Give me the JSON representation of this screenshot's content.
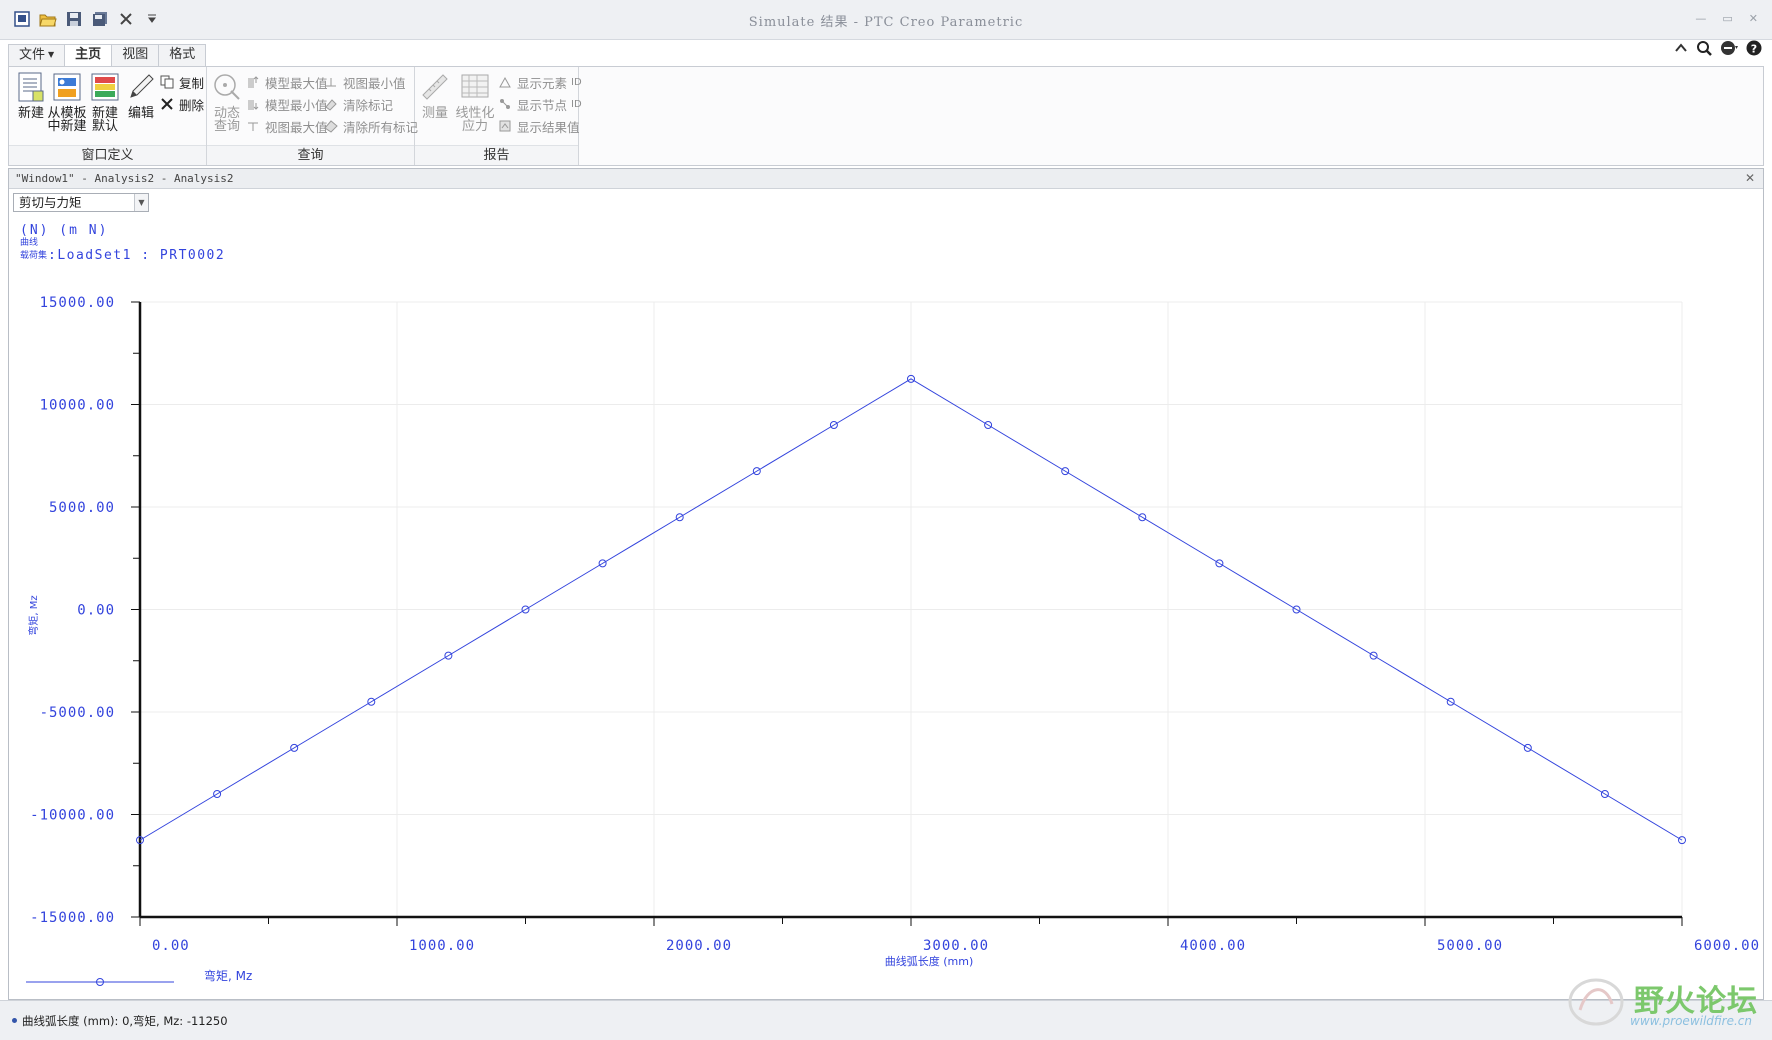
{
  "window": {
    "title": "Simulate 结果 - PTC Creo Parametric",
    "min": "—",
    "max": "▭",
    "close": "✕"
  },
  "tabs": [
    {
      "label": "文件"
    },
    {
      "label": "主页"
    },
    {
      "label": "视图"
    },
    {
      "label": "格式"
    }
  ],
  "ribbon": {
    "groups": {
      "window_def": "窗口定义",
      "query": "查询",
      "report": "报告"
    },
    "window_def": {
      "new": "新建",
      "from_template_1": "从模板",
      "from_template_2": "中新建",
      "new_default_1": "新建",
      "new_default_2": "默认",
      "edit": "编辑",
      "copy": "复制",
      "delete": "删除"
    },
    "query": {
      "dynamic_1": "动态",
      "dynamic_2": "查询",
      "model_max": "模型最大值",
      "model_min": "模型最小值",
      "view_max": "视图最大值",
      "view_min": "视图最小值",
      "clear_label": "清除标记",
      "clear_all_labels": "清除所有标记"
    },
    "report": {
      "measure": "测量",
      "linearize_1": "线性化",
      "linearize_2": "应力",
      "show_element_id": "显示元素",
      "show_node_id": "显示节点",
      "id_suffix": "ID",
      "show_result_value": "显示结果值"
    }
  },
  "result_window": {
    "title": "\"Window1\" - Analysis2 - Analysis2",
    "dropdown_value": "剪切与力矩"
  },
  "chart_data": {
    "type": "line",
    "units_line": "(N)  (m N)",
    "curve_label": "曲线",
    "loadset_label": "载荷集",
    "loadset_value": ":LoadSet1 :  PRT0002",
    "xlabel": "曲线弧长度 (mm)",
    "ylabel": "弯矩, Mz",
    "xlim": [
      0,
      6000
    ],
    "ylim": [
      -15000,
      15000
    ],
    "x_ticks": [
      "0.00",
      "1000.00",
      "2000.00",
      "3000.00",
      "4000.00",
      "5000.00",
      "6000.00"
    ],
    "y_ticks": [
      "15000.00",
      "10000.00",
      "5000.00",
      "0.00",
      "-5000.00",
      "-10000.00",
      "-15000.00"
    ],
    "legend": "弯矩, Mz",
    "line_color": "#3344dd",
    "series": [
      {
        "name": "弯矩, Mz",
        "x": [
          0,
          300,
          600,
          900,
          1200,
          1500,
          1800,
          2100,
          2400,
          2700,
          3000,
          3300,
          3600,
          3900,
          4200,
          4500,
          4800,
          5100,
          5400,
          5700,
          6000
        ],
        "y": [
          -11250,
          -9000,
          -6750,
          -4500,
          -2250,
          0,
          2250,
          4500,
          6750,
          9000,
          11250,
          9000,
          6750,
          4500,
          2250,
          0,
          -2250,
          -4500,
          -6750,
          -9000,
          -11250
        ]
      }
    ]
  },
  "status": {
    "text": "曲线弧长度 (mm): 0,弯矩, Mz: -11250"
  },
  "watermark": {
    "title": "野火论坛",
    "url": "www.proewildfire.cn"
  }
}
